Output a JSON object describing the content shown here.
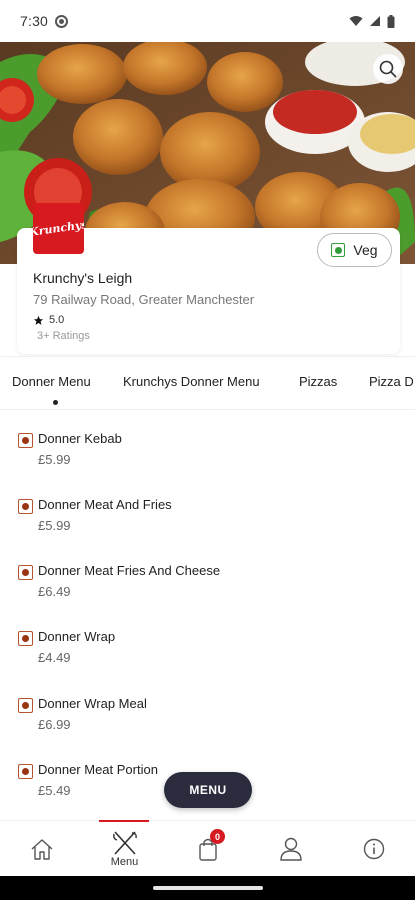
{
  "status_bar": {
    "time": "7:30"
  },
  "restaurant": {
    "logo_text": "Krunchys",
    "name": "Krunchy's Leigh",
    "address": "79 Railway Road, Greater Manchester",
    "rating": "5.0",
    "ratings_count": "3+ Ratings",
    "veg_label": "Veg"
  },
  "category_tabs": [
    "Donner Menu",
    "Krunchys Donner Menu",
    "Pizzas",
    "Pizza D"
  ],
  "menu_items": [
    {
      "name": "Donner Kebab",
      "price": "£5.99"
    },
    {
      "name": "Donner Meat And Fries",
      "price": "£5.99"
    },
    {
      "name": "Donner Meat Fries And Cheese",
      "price": "£6.49"
    },
    {
      "name": "Donner Wrap",
      "price": "£4.49"
    },
    {
      "name": "Donner Wrap Meal",
      "price": "£6.99"
    },
    {
      "name": "Donner Meat Portion",
      "price": "£5.49"
    }
  ],
  "menu_button": "MENU",
  "bottom_nav": {
    "menu_label": "Menu",
    "cart_count": "0"
  },
  "colors": {
    "brand_red": "#d71920",
    "veg_green": "#2e9d3a",
    "nonveg_brown": "#9a3412",
    "fab_dark": "#2a2b3d"
  }
}
